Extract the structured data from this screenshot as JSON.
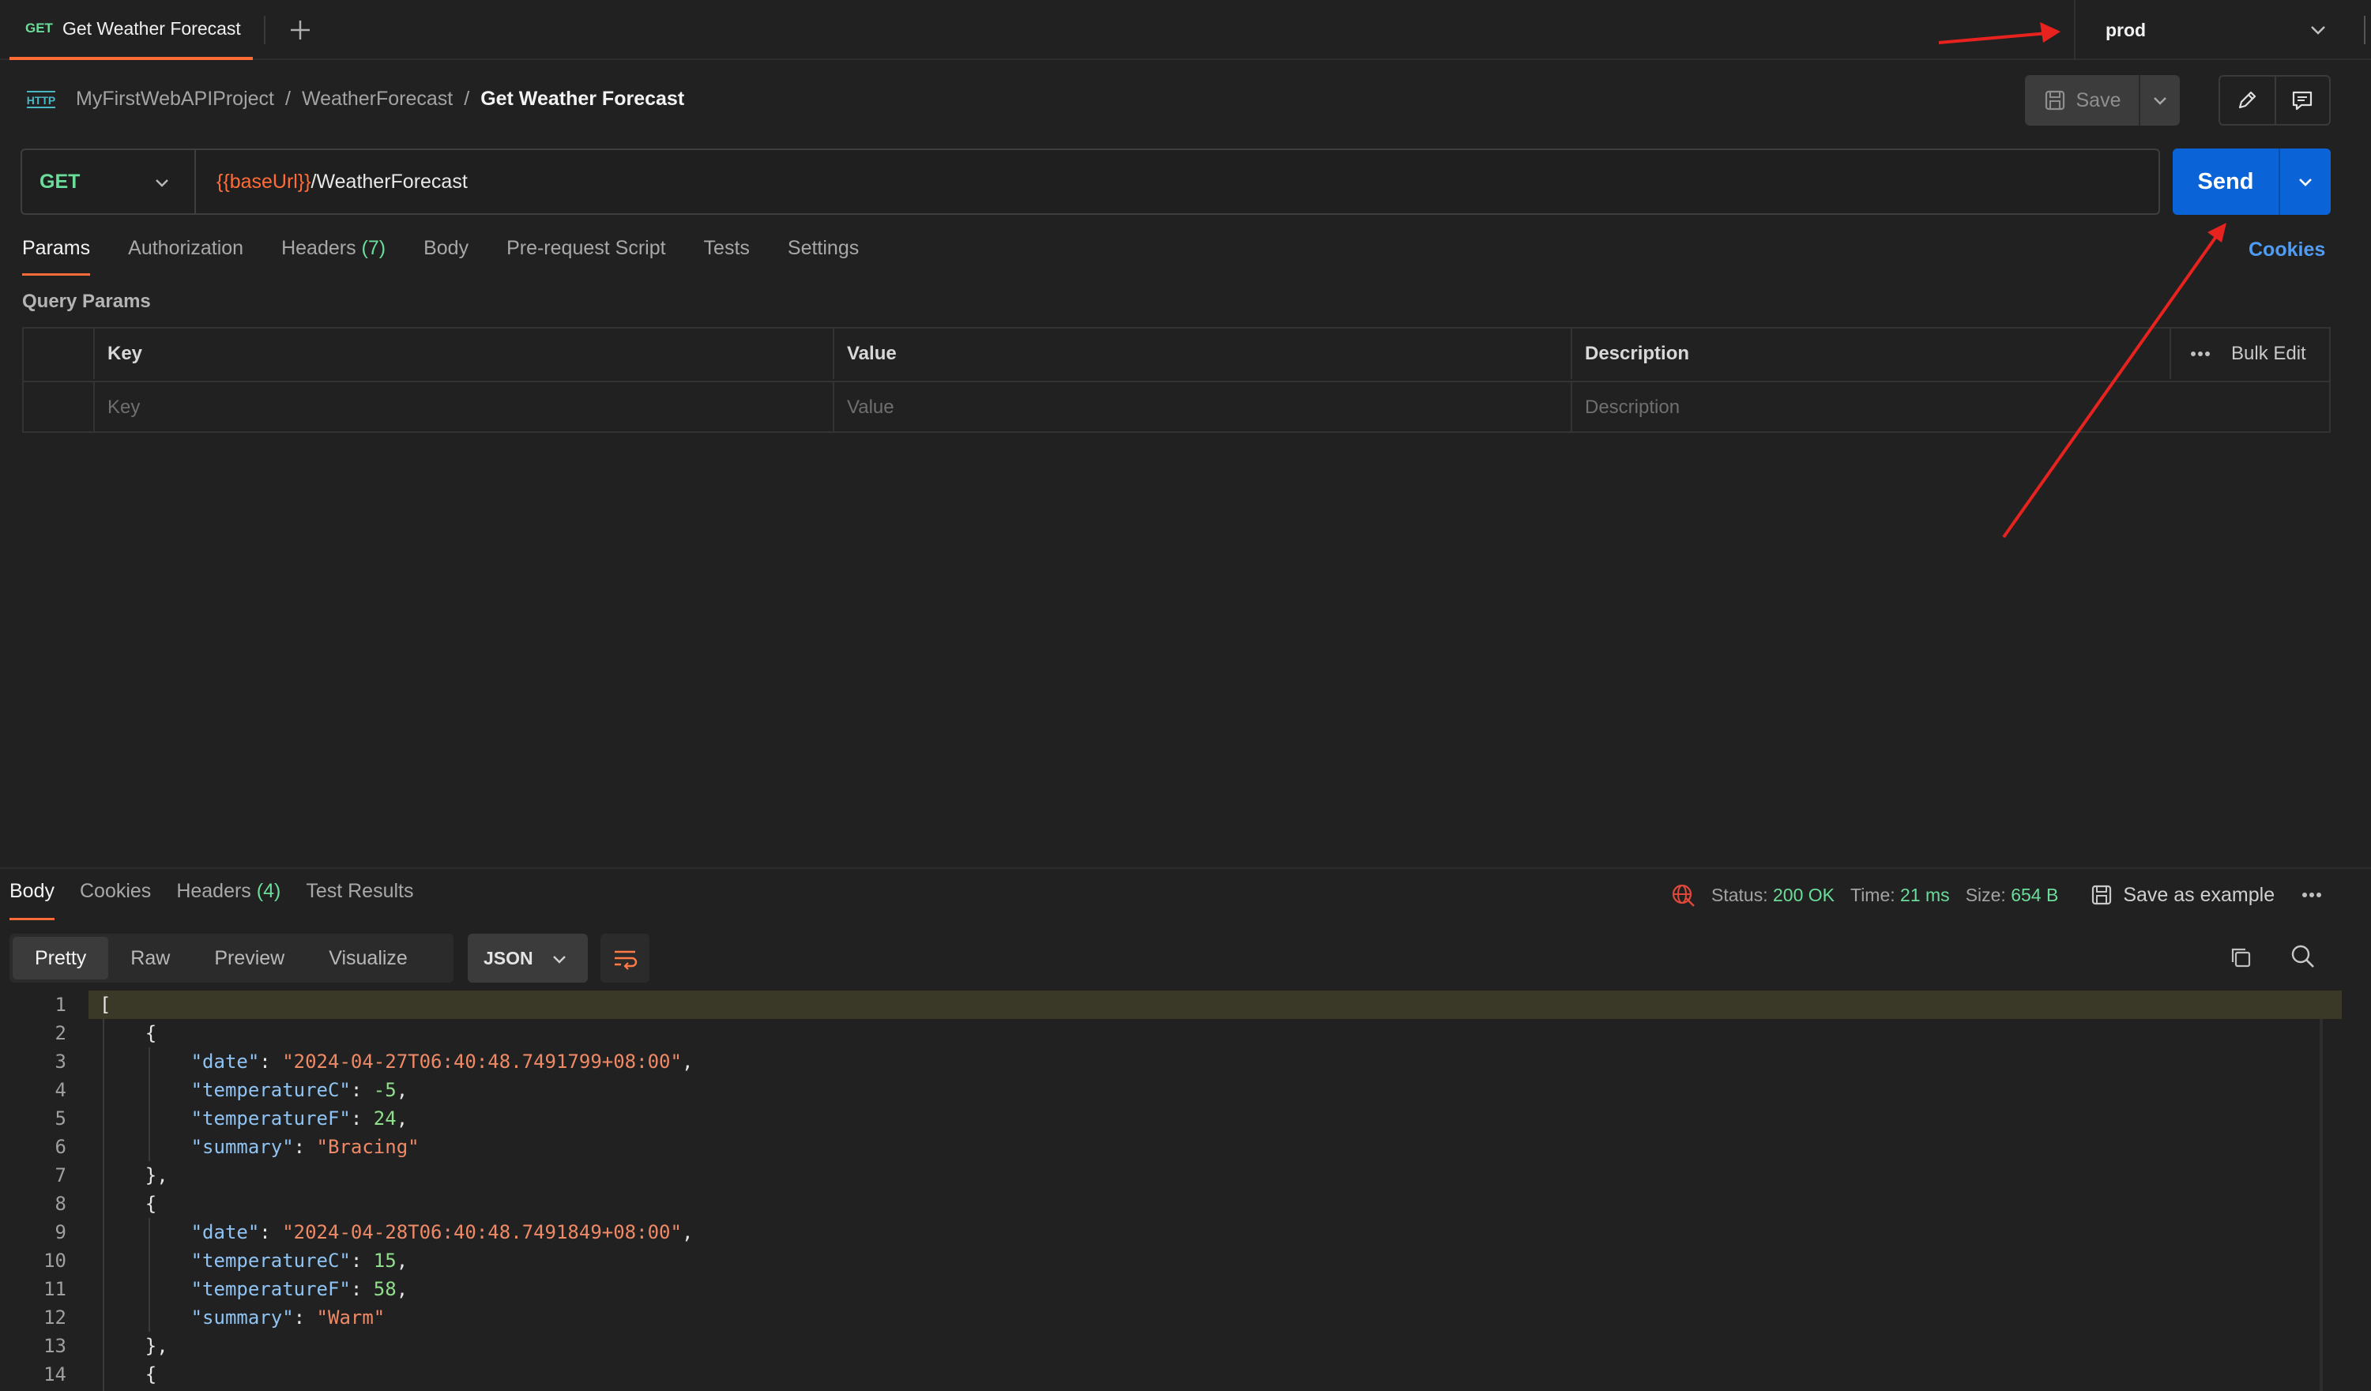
{
  "tab": {
    "method": "GET",
    "title": "Get Weather Forecast"
  },
  "environment": {
    "selected": "prod"
  },
  "breadcrumb": {
    "icon_text": "HTTP",
    "items": [
      "MyFirstWebAPIProject",
      "WeatherForecast",
      "Get Weather Forecast"
    ],
    "separator": "/"
  },
  "toolbar": {
    "save_label": "Save"
  },
  "request": {
    "method": "GET",
    "url_variable": "{{baseUrl}}",
    "url_path": "/WeatherForecast",
    "send_label": "Send"
  },
  "request_tabs": [
    {
      "label": "Params"
    },
    {
      "label": "Authorization"
    },
    {
      "label": "Headers",
      "count": "(7)"
    },
    {
      "label": "Body"
    },
    {
      "label": "Pre-request Script"
    },
    {
      "label": "Tests"
    },
    {
      "label": "Settings"
    }
  ],
  "cookies_link": "Cookies",
  "query_params": {
    "title": "Query Params",
    "headers": [
      "Key",
      "Value",
      "Description"
    ],
    "bulk_edit": "Bulk Edit",
    "placeholders": [
      "Key",
      "Value",
      "Description"
    ]
  },
  "response_tabs": [
    {
      "label": "Body"
    },
    {
      "label": "Cookies"
    },
    {
      "label": "Headers",
      "count": "(4)"
    },
    {
      "label": "Test Results"
    }
  ],
  "response_meta": {
    "status_label": "Status:",
    "status_value": "200 OK",
    "time_label": "Time:",
    "time_value": "21 ms",
    "size_label": "Size:",
    "size_value": "654 B",
    "save_example": "Save as example"
  },
  "format_tabs": [
    "Pretty",
    "Raw",
    "Preview",
    "Visualize"
  ],
  "format_select": "JSON",
  "code_lines": [
    {
      "n": "1",
      "html": "["
    },
    {
      "n": "2",
      "html": "    {"
    },
    {
      "n": "3",
      "key": "date",
      "val": "\"2024-04-27T06:40:48.7491799+08:00\"",
      "type": "s",
      "indent": 2,
      "comma": true
    },
    {
      "n": "4",
      "key": "temperatureC",
      "val": "-5",
      "type": "n",
      "indent": 2,
      "comma": true
    },
    {
      "n": "5",
      "key": "temperatureF",
      "val": "24",
      "type": "n",
      "indent": 2,
      "comma": true
    },
    {
      "n": "6",
      "key": "summary",
      "val": "\"Bracing\"",
      "type": "s",
      "indent": 2,
      "comma": false
    },
    {
      "n": "7",
      "html": "    },"
    },
    {
      "n": "8",
      "html": "    {"
    },
    {
      "n": "9",
      "key": "date",
      "val": "\"2024-04-28T06:40:48.7491849+08:00\"",
      "type": "s",
      "indent": 2,
      "comma": true
    },
    {
      "n": "10",
      "key": "temperatureC",
      "val": "15",
      "type": "n",
      "indent": 2,
      "comma": true
    },
    {
      "n": "11",
      "key": "temperatureF",
      "val": "58",
      "type": "n",
      "indent": 2,
      "comma": true
    },
    {
      "n": "12",
      "key": "summary",
      "val": "\"Warm\"",
      "type": "s",
      "indent": 2,
      "comma": false
    },
    {
      "n": "13",
      "html": "    },"
    },
    {
      "n": "14",
      "html": "    {"
    }
  ],
  "colors": {
    "accent": "#ff6c37",
    "send": "#0a64d8",
    "method_get": "#6bdd9a",
    "annotation_arrow": "#e8231f"
  }
}
